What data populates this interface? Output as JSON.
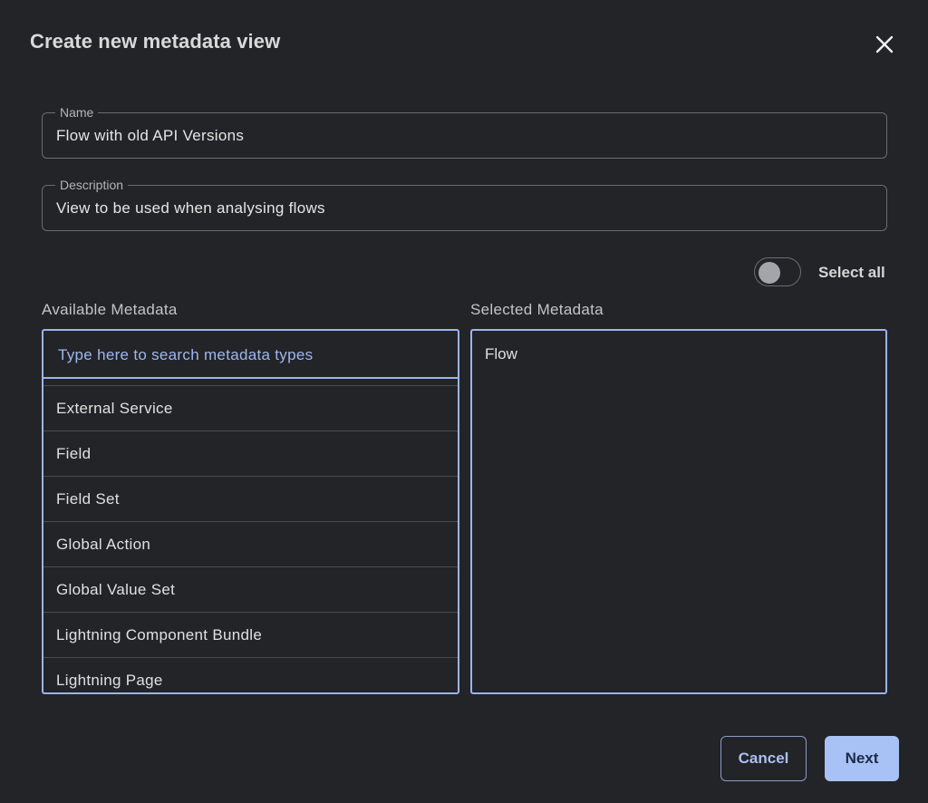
{
  "dialog": {
    "title": "Create new metadata view"
  },
  "name_field": {
    "label": "Name",
    "value": "Flow with old API Versions"
  },
  "description_field": {
    "label": "Description",
    "value": "View to be used when analysing flows"
  },
  "select_all": {
    "label": "Select all",
    "checked": false
  },
  "available": {
    "label": "Available Metadata",
    "search_placeholder": "Type here to search metadata types",
    "items": [
      {
        "label": "External Service"
      },
      {
        "label": "Field"
      },
      {
        "label": "Field Set"
      },
      {
        "label": "Global Action"
      },
      {
        "label": "Global Value Set"
      },
      {
        "label": "Lightning Component Bundle"
      },
      {
        "label": "Lightning Page"
      }
    ]
  },
  "selected": {
    "label": "Selected Metadata",
    "items": [
      {
        "label": "Flow"
      }
    ]
  },
  "footer": {
    "cancel_label": "Cancel",
    "next_label": "Next"
  },
  "colors": {
    "background": "#232427",
    "accent": "#9bb4ec",
    "primary_button": "#a9c2f5"
  }
}
